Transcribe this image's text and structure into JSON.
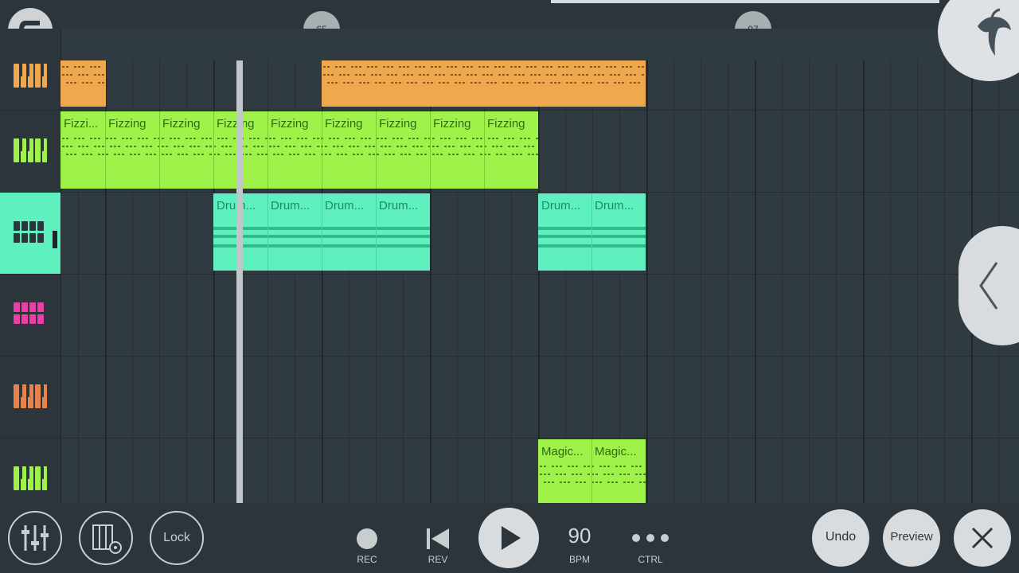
{
  "timeline": {
    "markers": [
      "65",
      "97"
    ]
  },
  "tracks": [
    {
      "icon": "orange-keys-icon",
      "color": "#f0a84e"
    },
    {
      "icon": "green-keys-icon",
      "color": "#9ef24a"
    },
    {
      "icon": "teal-pads-icon",
      "color": "#5ff0c0",
      "selected": true
    },
    {
      "icon": "pink-pads-icon",
      "color": "#ec3fa6"
    },
    {
      "icon": "orange-keys-icon",
      "color": "#e8834a"
    },
    {
      "icon": "green-keys-icon",
      "color": "#9ef24a"
    }
  ],
  "clips": {
    "track1_a": "",
    "track1_b": [
      "",
      "",
      "",
      "",
      "",
      ""
    ],
    "track2": [
      "Fizzi...",
      "Fizzing",
      "Fizzing",
      "Fizzing",
      "Fizzing",
      "Fizzing",
      "Fizzing",
      "Fizzing",
      "Fizzing"
    ],
    "track3_a": [
      "Drum...",
      "Drum...",
      "Drum...",
      "Drum..."
    ],
    "track3_b": [
      "Drum...",
      "Drum..."
    ],
    "track6": [
      "Magic...",
      "Magic..."
    ]
  },
  "toolbar": {
    "lock_label": "Lock",
    "rec_label": "REC",
    "rev_label": "REV",
    "bpm_value": "90",
    "bpm_label": "BPM",
    "ctrl_label": "CTRL",
    "undo_label": "Undo",
    "preview_label": "Preview"
  },
  "colors": {
    "background": "#2f3940",
    "orange": "#f0a84e",
    "green": "#9ef24a",
    "teal": "#5ff0c0",
    "pink": "#ec3fa6",
    "button_fill": "#d9dcde"
  }
}
